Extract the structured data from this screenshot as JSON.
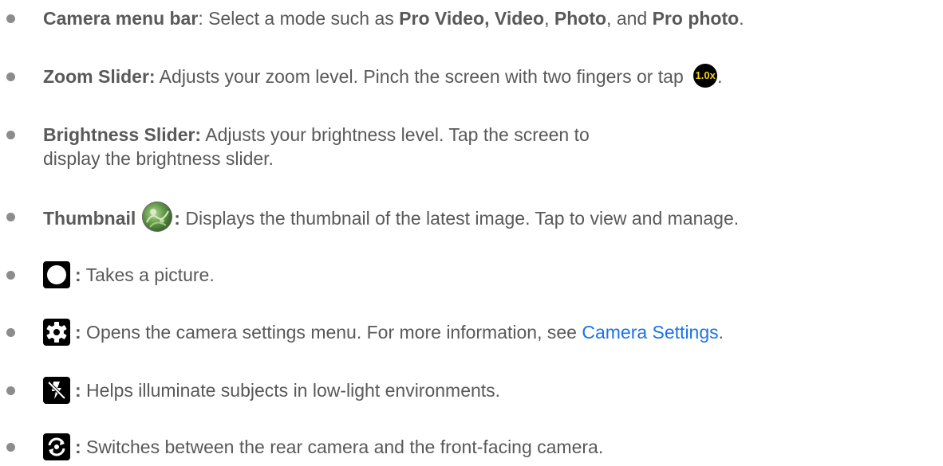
{
  "items": [
    {
      "label": "Camera menu bar",
      "text_a": ": Select a mode such as ",
      "mode1": "Pro Video, Video",
      "sep1": ", ",
      "mode2": "Photo",
      "sep2": ", and ",
      "mode3": "Pro photo",
      "end": "."
    },
    {
      "label": "Zoom Slider:",
      "text_a": " Adjusts your zoom level. Pinch the screen with two fingers or tap ",
      "badge": "1.0x",
      "end": "."
    },
    {
      "label": "Brightness Slider:",
      "text_a": " Adjusts your brightness level. Tap the screen to display the brightness slider."
    },
    {
      "label": "Thumbnail",
      "colon": ":",
      "text_a": " Displays the thumbnail of the latest image. Tap to view and manage."
    },
    {
      "colon": ":",
      "text_a": " Takes a picture."
    },
    {
      "colon": ":",
      "text_a": " Opens the camera settings menu. For more information, see ",
      "link": "Camera Settings",
      "end": "."
    },
    {
      "colon": ":",
      "text_a": " Helps illuminate subjects in low-light environments."
    },
    {
      "colon": ":",
      "text_a": " Switches between the rear camera and the front-facing camera."
    }
  ],
  "icons": {
    "zoom": "zoom-level-badge-icon",
    "thumbnail": "thumbnail-photo-icon",
    "shutter": "shutter-button-icon",
    "settings": "gear-icon",
    "flash": "flash-off-icon",
    "switch": "switch-camera-icon"
  },
  "colors": {
    "text": "#595959",
    "link": "#1a73e8",
    "badge_text": "#f5d300",
    "icon_bg": "#000000"
  }
}
